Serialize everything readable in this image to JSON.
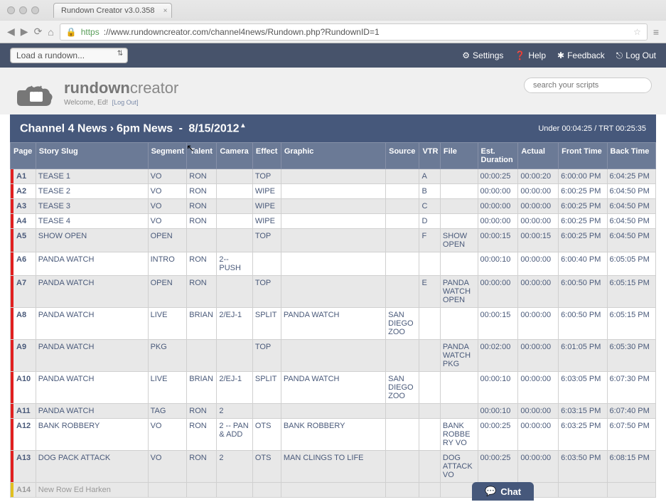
{
  "browser": {
    "tab_title": "Rundown Creator v3.0.358",
    "url_https": "https",
    "url_rest": "://www.rundowncreator.com/channel4news/Rundown.php?RundownID=1"
  },
  "toolbar": {
    "load_rundown": "Load a rundown...",
    "settings": "Settings",
    "help": "Help",
    "feedback": "Feedback",
    "logout": "Log Out"
  },
  "header": {
    "brand_bold": "rundown",
    "brand_light": "creator",
    "welcome": "Welcome, Ed!",
    "logout_link": "[Log Out]",
    "search_placeholder": "search your scripts"
  },
  "title": {
    "show": "Channel 4 News",
    "broadcast": "6pm News",
    "date": "8/15/2012",
    "timing": "Under 00:04:25 / TRT 00:25:35"
  },
  "columns": [
    "Page",
    "Story Slug",
    "Segment",
    "Talent",
    "Camera",
    "Effect",
    "Graphic",
    "Source",
    "VTR",
    "File",
    "Est. Duration",
    "Actual",
    "Front Time",
    "Back Time"
  ],
  "rows": [
    {
      "page": "A1",
      "slug": "TEASE 1",
      "segment": "VO",
      "talent": "RON",
      "camera": "",
      "effect": "TOP",
      "graphic": "",
      "source": "",
      "vtr": "A",
      "file": "",
      "est": "00:00:25",
      "actual": "00:00:20",
      "front": "6:00:00 PM",
      "back": "6:04:25 PM",
      "stripe": "red",
      "alt": true
    },
    {
      "page": "A2",
      "slug": "TEASE 2",
      "segment": "VO",
      "talent": "RON",
      "camera": "",
      "effect": "WIPE",
      "graphic": "",
      "source": "",
      "vtr": "B",
      "file": "",
      "est": "00:00:00",
      "actual": "00:00:00",
      "front": "6:00:25 PM",
      "back": "6:04:50 PM",
      "stripe": "red",
      "alt": false
    },
    {
      "page": "A3",
      "slug": "TEASE 3",
      "segment": "VO",
      "talent": "RON",
      "camera": "",
      "effect": "WIPE",
      "graphic": "",
      "source": "",
      "vtr": "C",
      "file": "",
      "est": "00:00:00",
      "actual": "00:00:00",
      "front": "6:00:25 PM",
      "back": "6:04:50 PM",
      "stripe": "red",
      "alt": true
    },
    {
      "page": "A4",
      "slug": "TEASE 4",
      "segment": "VO",
      "talent": "RON",
      "camera": "",
      "effect": "WIPE",
      "graphic": "",
      "source": "",
      "vtr": "D",
      "file": "",
      "est": "00:00:00",
      "actual": "00:00:00",
      "front": "6:00:25 PM",
      "back": "6:04:50 PM",
      "stripe": "red",
      "alt": false
    },
    {
      "page": "A5",
      "slug": "SHOW OPEN",
      "segment": "OPEN",
      "talent": "",
      "camera": "",
      "effect": "TOP",
      "graphic": "",
      "source": "",
      "vtr": "F",
      "file": "SHOW OPEN",
      "est": "00:00:15",
      "actual": "00:00:15",
      "front": "6:00:25 PM",
      "back": "6:04:50 PM",
      "stripe": "red",
      "alt": true
    },
    {
      "page": "A6",
      "slug": "PANDA WATCH",
      "segment": "INTRO",
      "talent": "RON",
      "camera": "2--PUSH",
      "effect": "",
      "graphic": "",
      "source": "",
      "vtr": "",
      "file": "",
      "est": "00:00:10",
      "actual": "00:00:00",
      "front": "6:00:40 PM",
      "back": "6:05:05 PM",
      "stripe": "red",
      "alt": false
    },
    {
      "page": "A7",
      "slug": "PANDA WATCH",
      "segment": "OPEN",
      "talent": "RON",
      "camera": "",
      "effect": "TOP",
      "graphic": "",
      "source": "",
      "vtr": "E",
      "file": "PANDA WATCH OPEN",
      "est": "00:00:00",
      "actual": "00:00:00",
      "front": "6:00:50 PM",
      "back": "6:05:15 PM",
      "stripe": "red",
      "alt": true
    },
    {
      "page": "A8",
      "slug": "PANDA WATCH",
      "segment": "LIVE",
      "talent": "BRIAN",
      "camera": "2/EJ-1",
      "effect": "SPLIT",
      "graphic": "PANDA WATCH",
      "source": "SAN DIEGO ZOO",
      "vtr": "",
      "file": "",
      "est": "00:00:15",
      "actual": "00:00:00",
      "front": "6:00:50 PM",
      "back": "6:05:15 PM",
      "stripe": "red",
      "alt": false
    },
    {
      "page": "A9",
      "slug": "PANDA WATCH",
      "segment": "PKG",
      "talent": "",
      "camera": "",
      "effect": "TOP",
      "graphic": "",
      "source": "",
      "vtr": "",
      "file": "PANDA WATCH PKG",
      "est": "00:02:00",
      "actual": "00:00:00",
      "front": "6:01:05 PM",
      "back": "6:05:30 PM",
      "stripe": "red",
      "alt": true
    },
    {
      "page": "A10",
      "slug": "PANDA WATCH",
      "segment": "LIVE",
      "talent": "BRIAN",
      "camera": "2/EJ-1",
      "effect": "SPLIT",
      "graphic": "PANDA WATCH",
      "source": "SAN DIEGO ZOO",
      "vtr": "",
      "file": "",
      "est": "00:00:10",
      "actual": "00:00:00",
      "front": "6:03:05 PM",
      "back": "6:07:30 PM",
      "stripe": "red",
      "alt": false
    },
    {
      "page": "A11",
      "slug": "PANDA WATCH",
      "segment": "TAG",
      "talent": "RON",
      "camera": "2",
      "effect": "",
      "graphic": "",
      "source": "",
      "vtr": "",
      "file": "",
      "est": "00:00:10",
      "actual": "00:00:00",
      "front": "6:03:15 PM",
      "back": "6:07:40 PM",
      "stripe": "red",
      "alt": true
    },
    {
      "page": "A12",
      "slug": "BANK ROBBERY",
      "segment": "VO",
      "talent": "RON",
      "camera": "2 -- PAN & ADD",
      "effect": "OTS",
      "graphic": "BANK ROBBERY",
      "source": "",
      "vtr": "",
      "file": "BANK ROBBERY VO",
      "est": "00:00:25",
      "actual": "00:00:00",
      "front": "6:03:25 PM",
      "back": "6:07:50 PM",
      "stripe": "red",
      "alt": false
    },
    {
      "page": "A13",
      "slug": "DOG PACK ATTACK",
      "segment": "VO",
      "talent": "RON",
      "camera": "2",
      "effect": "OTS",
      "graphic": "MAN CLINGS TO LIFE",
      "source": "",
      "vtr": "",
      "file": "DOG ATTACK VO",
      "est": "00:00:25",
      "actual": "00:00:00",
      "front": "6:03:50 PM",
      "back": "6:08:15 PM",
      "stripe": "red",
      "alt": true
    },
    {
      "page": "A14",
      "slug": "New Row Ed Harken",
      "segment": "",
      "talent": "",
      "camera": "",
      "effect": "",
      "graphic": "",
      "source": "",
      "vtr": "",
      "file": "",
      "est": "",
      "actual": "",
      "front": "",
      "back": "",
      "stripe": "yellow",
      "alt": true,
      "newrow": true
    }
  ],
  "chat": {
    "label": "Chat"
  }
}
